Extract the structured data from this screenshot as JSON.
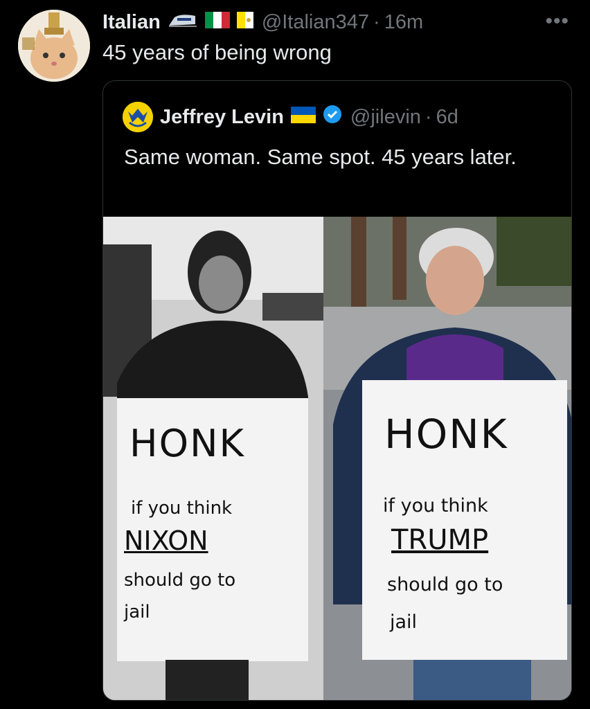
{
  "tweet": {
    "author_name": "Italian",
    "handle": "@Italian347",
    "separator": "·",
    "time": "16m",
    "text": "45 years of being wrong",
    "more_icon": "more-horizontal-icon"
  },
  "quoted": {
    "author_name": "Jeffrey Levin",
    "handle": "@jilevin",
    "separator": "·",
    "time": "6d",
    "text": "Same woman. Same spot. 45 years later.",
    "verified_color": "#1d9bf0"
  },
  "media": {
    "left_sign": {
      "line1": "HONK",
      "line2": "if you think",
      "line3": "NIXON",
      "line4": "should go to",
      "line5": "jail"
    },
    "right_sign": {
      "line1": "HONK",
      "line2": "if you think",
      "line3": "TRUMP",
      "line4": "should go to",
      "line5": "jail"
    }
  },
  "colors": {
    "background": "#000000",
    "text": "#e7e9ea",
    "muted": "#71767b",
    "border": "#2f3336"
  }
}
